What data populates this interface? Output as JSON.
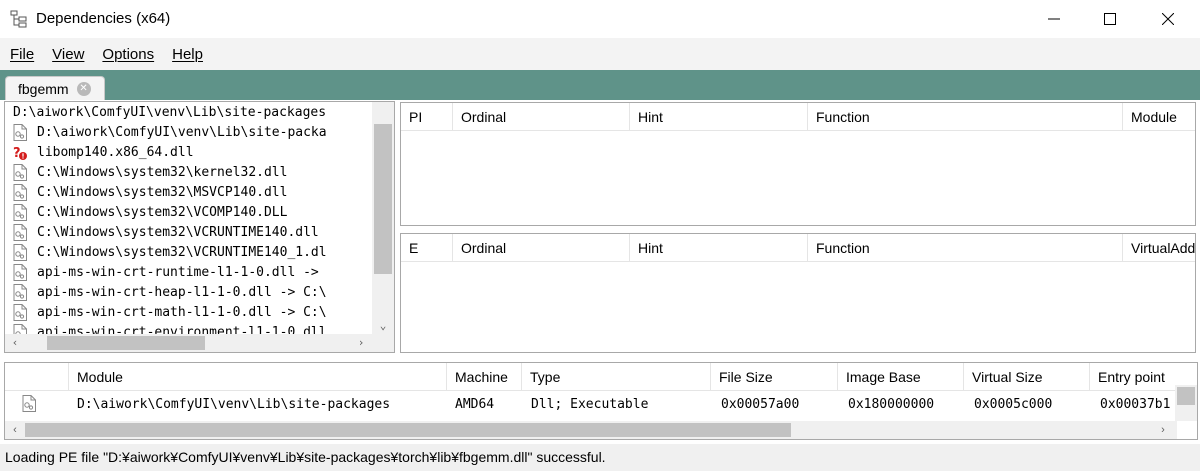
{
  "window": {
    "title": "Dependencies (x64)",
    "icon": "dependency-tree-icon"
  },
  "menu": {
    "items": [
      "File",
      "View",
      "Options",
      "Help"
    ]
  },
  "tabs": [
    {
      "label": "fbgemm",
      "close_icon": "close-circle-icon"
    }
  ],
  "tree": {
    "root": "D:\\aiwork\\ComfyUI\\venv\\Lib\\site-packages",
    "children": [
      {
        "label": "D:\\aiwork\\ComfyUI\\venv\\Lib\\site-packa",
        "icon": "module-file-icon",
        "status": "ok"
      },
      {
        "label": "libomp140.x86_64.dll",
        "icon": "missing-module-icon",
        "status": "missing"
      },
      {
        "label": "C:\\Windows\\system32\\kernel32.dll",
        "icon": "module-file-icon",
        "status": "ok"
      },
      {
        "label": "C:\\Windows\\system32\\MSVCP140.dll",
        "icon": "module-file-icon",
        "status": "ok"
      },
      {
        "label": "C:\\Windows\\system32\\VCOMP140.DLL",
        "icon": "module-file-icon",
        "status": "ok"
      },
      {
        "label": "C:\\Windows\\system32\\VCRUNTIME140.dll",
        "icon": "module-file-icon",
        "status": "ok"
      },
      {
        "label": "C:\\Windows\\system32\\VCRUNTIME140_1.dl",
        "icon": "module-file-icon",
        "status": "ok"
      },
      {
        "label": "api-ms-win-crt-runtime-l1-1-0.dll ->",
        "icon": "module-file-icon",
        "status": "ok"
      },
      {
        "label": "api-ms-win-crt-heap-l1-1-0.dll -> C:\\",
        "icon": "module-file-icon",
        "status": "ok"
      },
      {
        "label": "api-ms-win-crt-math-l1-1-0.dll -> C:\\",
        "icon": "module-file-icon",
        "status": "ok"
      },
      {
        "label": "api-ms-win-crt-environment-l1-1-0.dll",
        "icon": "module-file-icon",
        "status": "ok"
      }
    ]
  },
  "imports": {
    "columns": [
      "PI",
      "Ordinal",
      "Hint",
      "Function",
      "Module"
    ]
  },
  "exports": {
    "columns": [
      "E",
      "Ordinal",
      "Hint",
      "Function",
      "VirtualAdd"
    ]
  },
  "modules": {
    "columns": [
      "",
      "Module",
      "Machine",
      "Type",
      "File Size",
      "Image Base",
      "Virtual Size",
      "Entry point"
    ],
    "rows": [
      {
        "module": "D:\\aiwork\\ComfyUI\\venv\\Lib\\site-packages",
        "machine": "AMD64",
        "type": "Dll; Executable",
        "file_size": "0x00057a00",
        "image_base": "0x180000000",
        "virtual_size": "0x0005c000",
        "entry_point": "0x00037b1"
      }
    ]
  },
  "status": {
    "text": "Loading PE file \"D:¥aiwork¥ComfyUI¥venv¥Lib¥site-packages¥torch¥lib¥fbgemm.dll\" successful."
  },
  "colors": {
    "tab_strip": "#5f9389",
    "missing_red": "#d41c1c"
  }
}
